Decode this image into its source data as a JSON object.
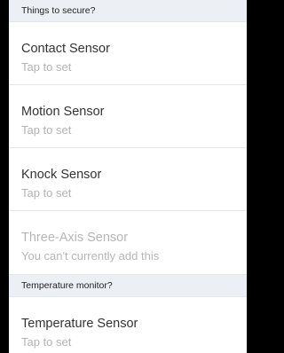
{
  "sections": [
    {
      "header": "Things to secure?",
      "items": [
        {
          "title": "Contact Sensor",
          "subtitle": "Tap to set",
          "enabled": true
        },
        {
          "title": "Motion Sensor",
          "subtitle": "Tap to set",
          "enabled": true
        },
        {
          "title": "Knock Sensor",
          "subtitle": "Tap to set",
          "enabled": true
        },
        {
          "title": "Three-Axis Sensor",
          "subtitle": "You can't currently add this",
          "enabled": false
        }
      ]
    },
    {
      "header": "Temperature monitor?",
      "items": [
        {
          "title": "Temperature Sensor",
          "subtitle": "Tap to set",
          "enabled": true
        }
      ]
    }
  ],
  "colors": {
    "header_bg": "#eceff4",
    "title_text": "#333333",
    "subtitle_text": "#b3b3b3",
    "disabled_text": "#b6b6b6"
  }
}
